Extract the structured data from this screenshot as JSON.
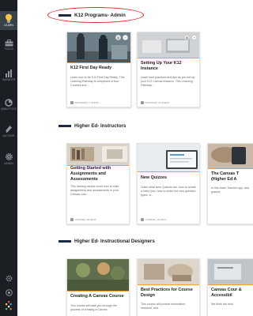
{
  "sidebar": {
    "items": [
      {
        "label": "LEARN",
        "icon": "lightbulb-icon"
      },
      {
        "label": "TOOLS",
        "icon": "toolbox-icon"
      },
      {
        "label": "INSIGHTS",
        "icon": "bar-chart-icon"
      },
      {
        "label": "ANALYTICS",
        "icon": "analytics-icon"
      },
      {
        "label": "AUTHOR",
        "icon": "pen-icon"
      },
      {
        "label": "ADMIN",
        "icon": "gear-icon"
      }
    ]
  },
  "sections": [
    {
      "title": "K12 Programs- Admin",
      "cards": [
        {
          "title": "K12 First Day Ready",
          "desc": "Learn how to be K12 First Day Ready. This Learning Pathway is comprised of four Courses and ...",
          "meta": "PROGRAM | 4 STEPS"
        },
        {
          "title": "Setting Up Your K12 Instance",
          "desc": "Learn best practices and tips as you set up your K12 Canvas instance. This Learning Pathway ...",
          "meta": "PROGRAM | 6 STEPS"
        }
      ]
    },
    {
      "title": "Higher Ed- Instructors",
      "cards": [
        {
          "title": "Getting Started with Assignments and Assessments",
          "desc": "This training course cover how to build assignments and assessments in your Canvas cour...",
          "meta": "COURSE | 60 MINS"
        },
        {
          "title": "New Quizzes",
          "desc": "Learn what New Quizzes are, how to create a New Quiz, how to utilize the new question types, a...",
          "meta": "COURSE | 30 MINS"
        },
        {
          "title": "The Canvas T (Higher Ed A",
          "desc": "In this instru Teacher app, and graded",
          "meta": ""
        }
      ]
    },
    {
      "title": "Higher Ed- Instructional Designers",
      "cards": [
        {
          "title": "Creating A Canvas Course",
          "desc": "This course will walk you through the process of creating a Canvas",
          "meta": ""
        },
        {
          "title": "Best Practices for Course Design",
          "desc": "This course will provide information, research, and",
          "meta": ""
        },
        {
          "title": "Canvas Cour & Accessibil",
          "desc": "We think the bout",
          "meta": ""
        }
      ]
    }
  ],
  "colors": {
    "sidebar_bg": "#1b1f24",
    "accent": "#ff9a3c",
    "section_bar": "#1f2a44",
    "highlight_oval": "#e0262a"
  }
}
